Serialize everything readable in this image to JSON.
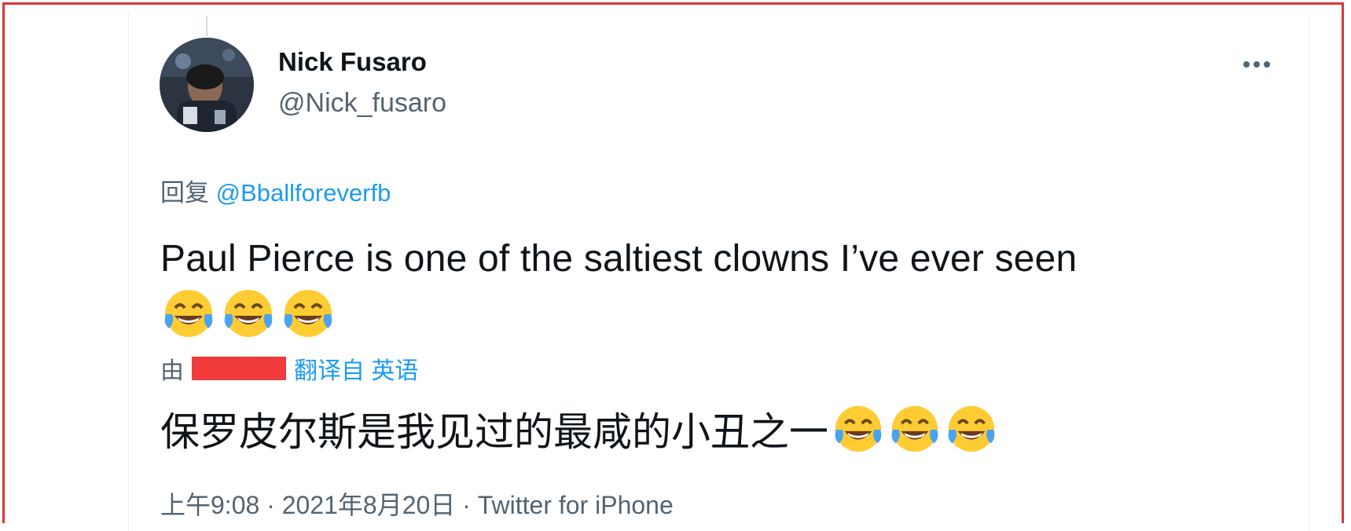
{
  "tweet": {
    "author_name": "Nick Fusaro",
    "author_handle": "@Nick_fusaro",
    "more_icon": "more-icon",
    "reply_prefix": "回复",
    "reply_to": "@Bballforeverfb",
    "text": "Paul Pierce is one of the saltiest clowns I’ve ever seen",
    "emoji_icon": "face-with-tears-of-joy-icon",
    "translation": {
      "by_prefix": "由",
      "translated_from_label": "翻译自 英语",
      "text": "保罗皮尔斯是我见过的最咸的小丑之一"
    },
    "time": "上午9:08",
    "separator": "·",
    "date": "2021年8月20日",
    "source": "Twitter for iPhone"
  },
  "colors": {
    "frame_border": "#d9363e",
    "accent": "#1d9bf0",
    "secondary_text": "#536471",
    "redaction": "#f23b3b"
  }
}
